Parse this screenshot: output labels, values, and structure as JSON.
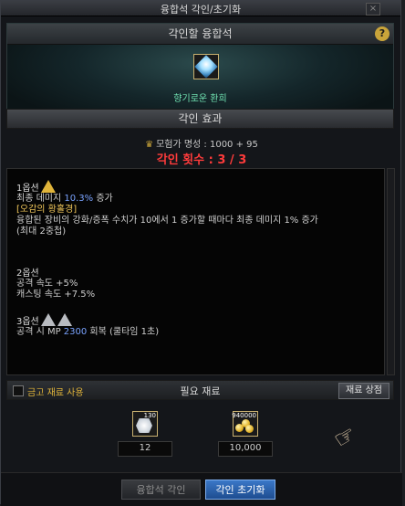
{
  "window": {
    "title": "융합석 각인/초기화",
    "close_label": "×"
  },
  "top": {
    "header": "각인할 융합석",
    "help_label": "?",
    "stone_name": "향기로운 환희"
  },
  "effect": {
    "header": "각인 효과",
    "fame_label": "모험가 명성 : 1000 + 95",
    "count_label": "각인 횟수 : 3 / 3"
  },
  "options": {
    "opt1": {
      "title": "1옵션",
      "line1_prefix": "최종 데미지 ",
      "line1_value": "10.3%",
      "line1_suffix": " 증가",
      "line2": "[오감의 황홀경]",
      "line3": "융합된 장비의 강화/증폭 수치가 10에서 1 증가할 때마다 최종 데미지 1% 증가",
      "line4": "(최대 2중첩)"
    },
    "opt2": {
      "title": "2옵션",
      "line1": "공격 속도 +5%",
      "line2": "캐스팅 속도 +7.5%"
    },
    "opt3": {
      "title": "3옵션",
      "line1_prefix": "공격 시 MP ",
      "line1_value": "2300",
      "line1_suffix": " 회복 (쿨타임 1초)"
    }
  },
  "materials": {
    "safe_label": "금고 재료 사용",
    "title": "필요 재료",
    "shop_label": "재료 상점",
    "item1_count": "130",
    "item1_qty": "12",
    "item2_count": "940000",
    "item2_qty": "10,000"
  },
  "bottom": {
    "tab_fuse_label": "융합석 각인",
    "tab_reset_label": "각인 초기화"
  },
  "colors": {
    "accent_blue": "#2f6cc0",
    "gold": "#e0b43a",
    "red": "#ff3b3b",
    "teal": "#6fe0b0"
  }
}
